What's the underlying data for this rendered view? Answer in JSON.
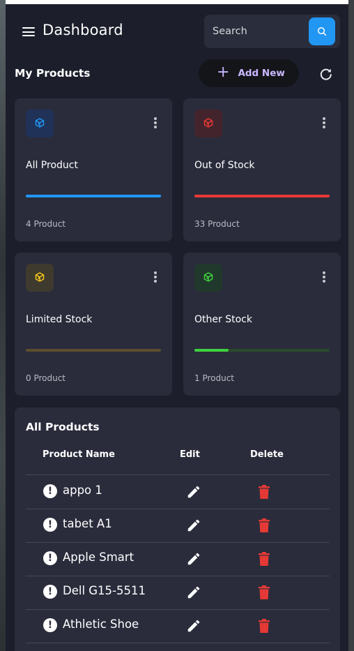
{
  "header": {
    "title": "Dashboard",
    "search_placeholder": "Search"
  },
  "section": {
    "title": "My Products",
    "add_label": "Add New"
  },
  "cards": [
    {
      "name": "All Product",
      "count": "4 Product",
      "icon": "cube-icon",
      "color": "#2196f3",
      "icon_bg": "#203257",
      "bar_bg": "#2196f3",
      "fill": 1.0
    },
    {
      "name": "Out of Stock",
      "count": "33 Product",
      "icon": "cube-icon",
      "color": "#e53935",
      "icon_bg": "#44242c",
      "bar_bg": "#e53935",
      "fill": 1.0
    },
    {
      "name": "Limited Stock",
      "count": "0 Product",
      "icon": "cube-icon",
      "color": "#f5c518",
      "icon_bg": "#3e3a2e",
      "bar_bg": "#5c4e2e",
      "fill": 0.0
    },
    {
      "name": "Other Stock",
      "count": "1 Product",
      "icon": "cube-icon",
      "color": "#3fd13f",
      "icon_bg": "#21392c",
      "bar_bg": "#2a4a2c",
      "fill": 0.25
    }
  ],
  "table": {
    "title": "All Products",
    "columns": [
      "Product Name",
      "Edit",
      "Delete"
    ],
    "rows": [
      {
        "name": "appo 1"
      },
      {
        "name": "tabet A1"
      },
      {
        "name": "Apple Smart"
      },
      {
        "name": "Dell G15-5511"
      },
      {
        "name": "Athletic Shoe"
      }
    ]
  },
  "colors": {
    "accent": "#2196f3",
    "add_text": "#c9b8ff",
    "delete": "#e53935",
    "panel": "#2a2c3c",
    "background": "#1c1e2b"
  }
}
